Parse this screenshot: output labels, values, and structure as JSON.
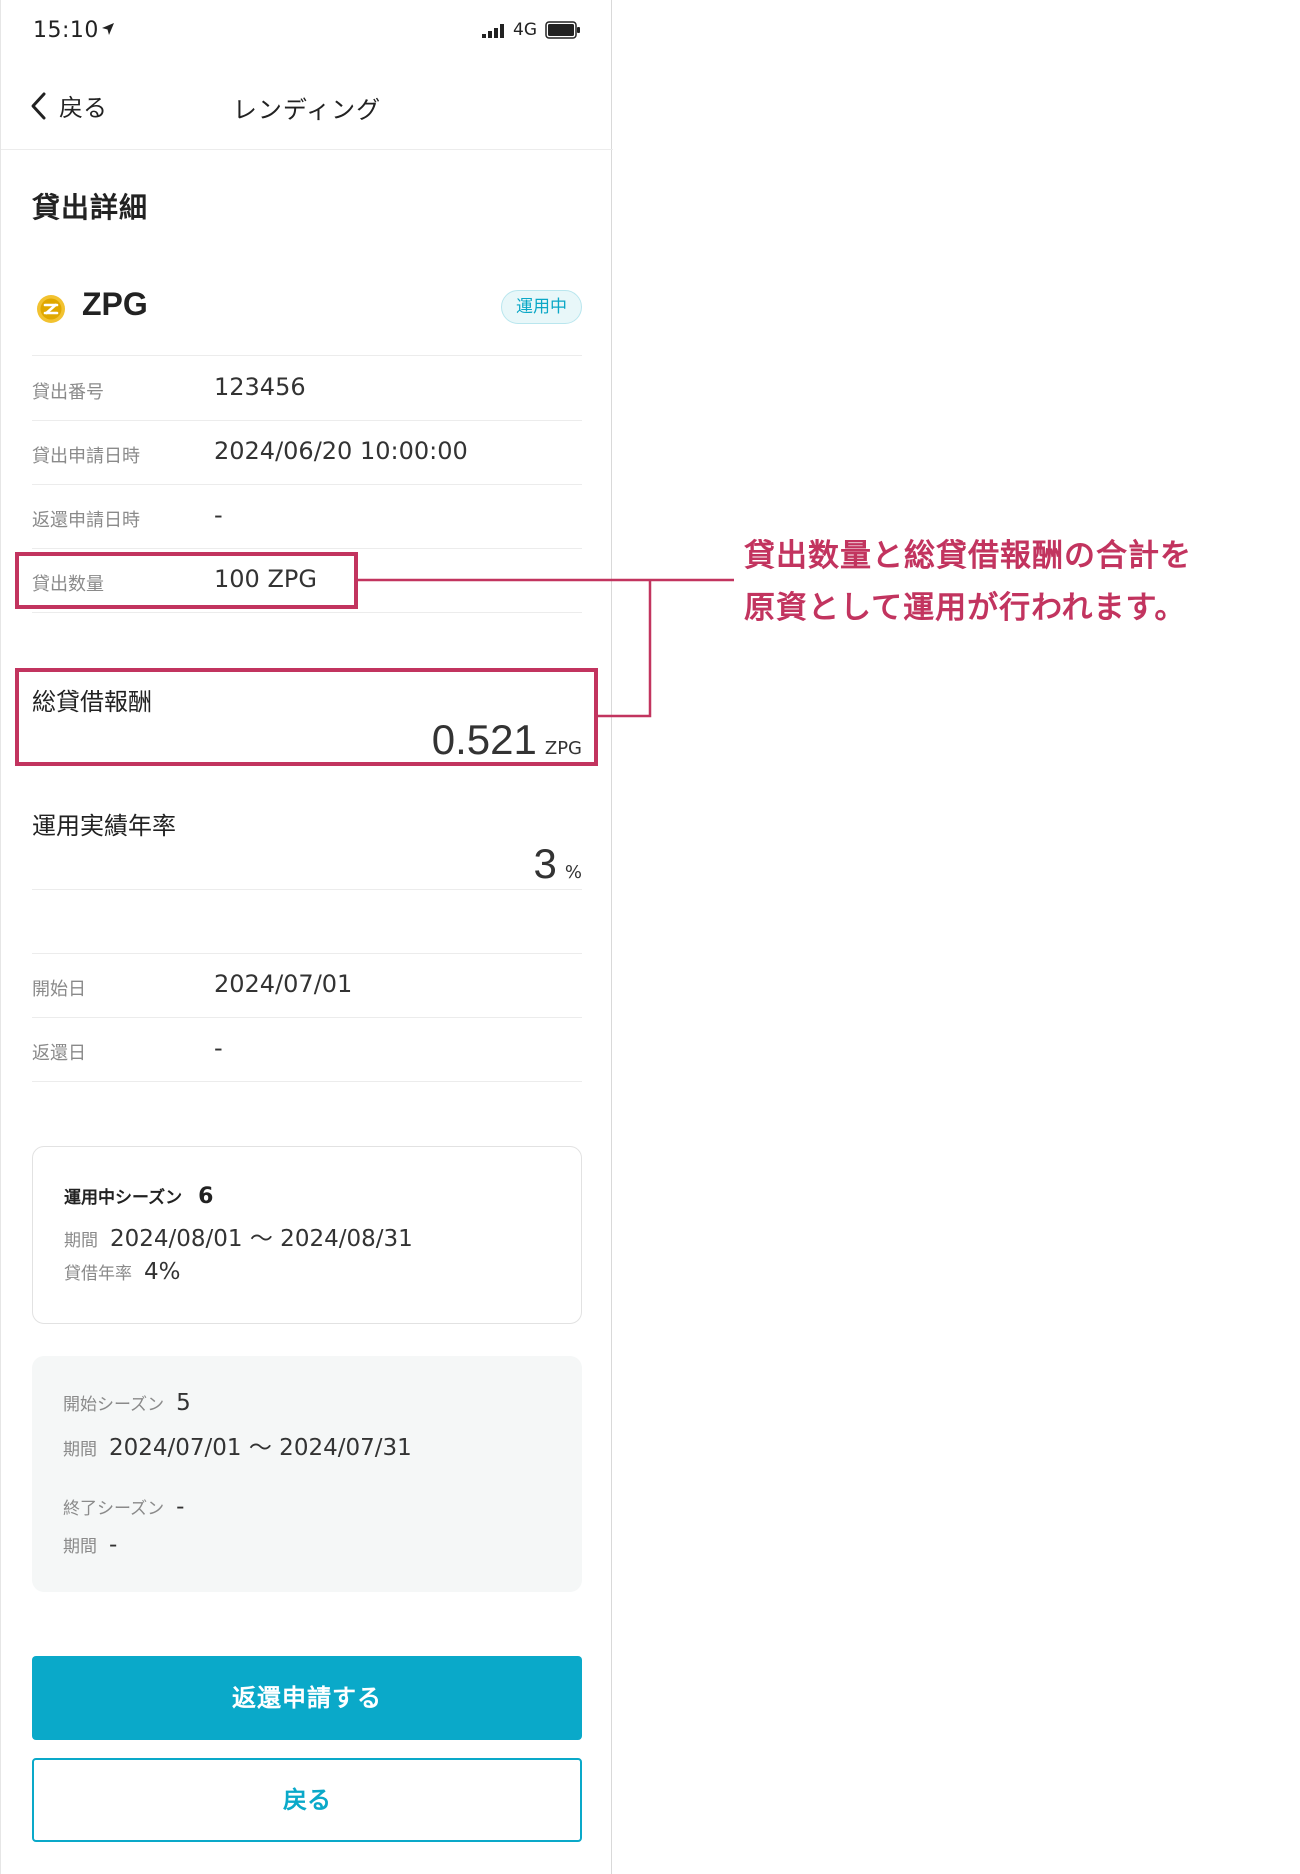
{
  "status_bar": {
    "time": "15:10",
    "network": "4G"
  },
  "nav": {
    "back_label": "戻る",
    "title": "レンディング"
  },
  "page_title": "貸出詳細",
  "coin": {
    "name": "ZPG",
    "status": "運用中",
    "icon_color": "#e0a800"
  },
  "details": [
    {
      "label": "貸出番号",
      "value": "123456"
    },
    {
      "label": "貸出申請日時",
      "value": "2024/06/20 10:00:00"
    },
    {
      "label": "返還申請日時",
      "value": "-"
    },
    {
      "label": "貸出数量",
      "value": "100 ZPG"
    }
  ],
  "reward": {
    "label": "総貸借報酬",
    "value": "0.521",
    "unit": "ZPG"
  },
  "annual_rate": {
    "label": "運用実績年率",
    "value": "3",
    "unit": "%"
  },
  "dates": [
    {
      "label": "開始日",
      "value": "2024/07/01"
    },
    {
      "label": "返還日",
      "value": "-"
    }
  ],
  "current_season": {
    "title": "運用中シーズン",
    "number": "6",
    "period_label": "期間",
    "period": "2024/08/01 〜 2024/08/31",
    "rate_label": "貸借年率",
    "rate": "4%"
  },
  "season_history": {
    "start_label": "開始シーズン",
    "start_value": "5",
    "start_period_label": "期間",
    "start_period": "2024/07/01 〜 2024/07/31",
    "end_label": "終了シーズン",
    "end_value": "-",
    "end_period_label": "期間",
    "end_period": "-"
  },
  "buttons": {
    "primary": "返還申請する",
    "secondary": "戻る"
  },
  "annotation": {
    "line1": "貸出数量と総貸借報酬の合計を",
    "line2": "原資として運用が行われます。",
    "color": "#c2345f"
  },
  "colors": {
    "accent": "#0aa9c9",
    "badge_bg": "#e8f7f9"
  }
}
